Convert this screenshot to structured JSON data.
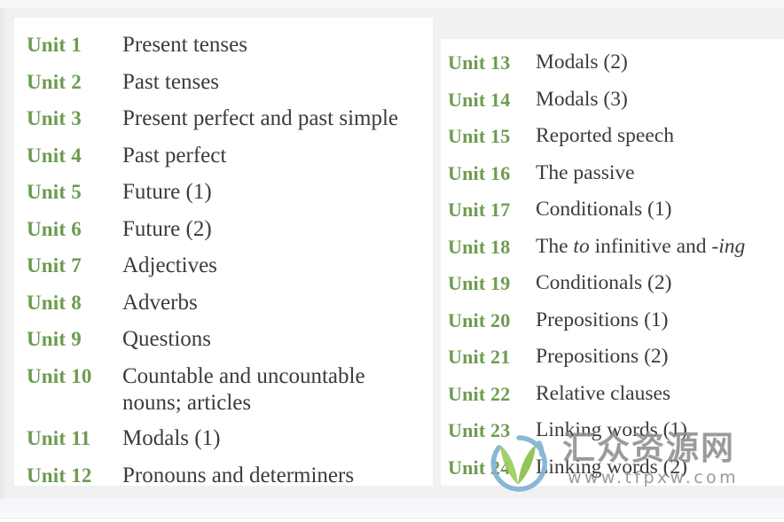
{
  "colors": {
    "unit_label_green": "#6d9b4f",
    "title_text": "#3b3b3b",
    "page_background": "#f1f1f1",
    "card_background": "#ffffff",
    "watermark_gray": "#8e8e8e",
    "watermark_leaf_green": "#8cc04e",
    "watermark_arc_blue": "#7fb2d4"
  },
  "left_column": {
    "name": "units-1-to-12",
    "rows": [
      {
        "unit": "Unit 1",
        "title": "Present tenses"
      },
      {
        "unit": "Unit 2",
        "title": "Past tenses"
      },
      {
        "unit": "Unit 3",
        "title": "Present perfect and past simple"
      },
      {
        "unit": "Unit 4",
        "title": "Past perfect"
      },
      {
        "unit": "Unit 5",
        "title": "Future (1)"
      },
      {
        "unit": "Unit 6",
        "title": "Future (2)"
      },
      {
        "unit": "Unit 7",
        "title": "Adjectives"
      },
      {
        "unit": "Unit 8",
        "title": "Adverbs"
      },
      {
        "unit": "Unit 9",
        "title": "Questions"
      },
      {
        "unit": "Unit 10",
        "title": "Countable and uncountable nouns; articles"
      },
      {
        "unit": "Unit 11",
        "title": "Modals (1)"
      },
      {
        "unit": "Unit 12",
        "title": "Pronouns and determiners"
      }
    ]
  },
  "right_column": {
    "name": "units-13-to-24",
    "rows": [
      {
        "unit": "Unit 13",
        "title": "Modals (2)"
      },
      {
        "unit": "Unit 14",
        "title": "Modals (3)"
      },
      {
        "unit": "Unit 15",
        "title": "Reported speech"
      },
      {
        "unit": "Unit 16",
        "title": "The passive"
      },
      {
        "unit": "Unit 17",
        "title": "Conditionals (1)"
      },
      {
        "unit": "Unit 18",
        "title": "The to infinitive and -ing",
        "italic_parts": [
          "to",
          "-ing"
        ]
      },
      {
        "unit": "Unit 19",
        "title": "Conditionals (2)"
      },
      {
        "unit": "Unit 20",
        "title": "Prepositions (1)"
      },
      {
        "unit": "Unit 21",
        "title": "Prepositions (2)"
      },
      {
        "unit": "Unit 22",
        "title": "Relative clauses"
      },
      {
        "unit": "Unit 23",
        "title": "Linking words (1)"
      },
      {
        "unit": "Unit 24",
        "title": "Linking words (2)"
      }
    ]
  },
  "watermark": {
    "chinese_text": "汇众资源网",
    "url_text": "www.tfpxw.com",
    "logo_name": "leaf-circle-logo"
  }
}
